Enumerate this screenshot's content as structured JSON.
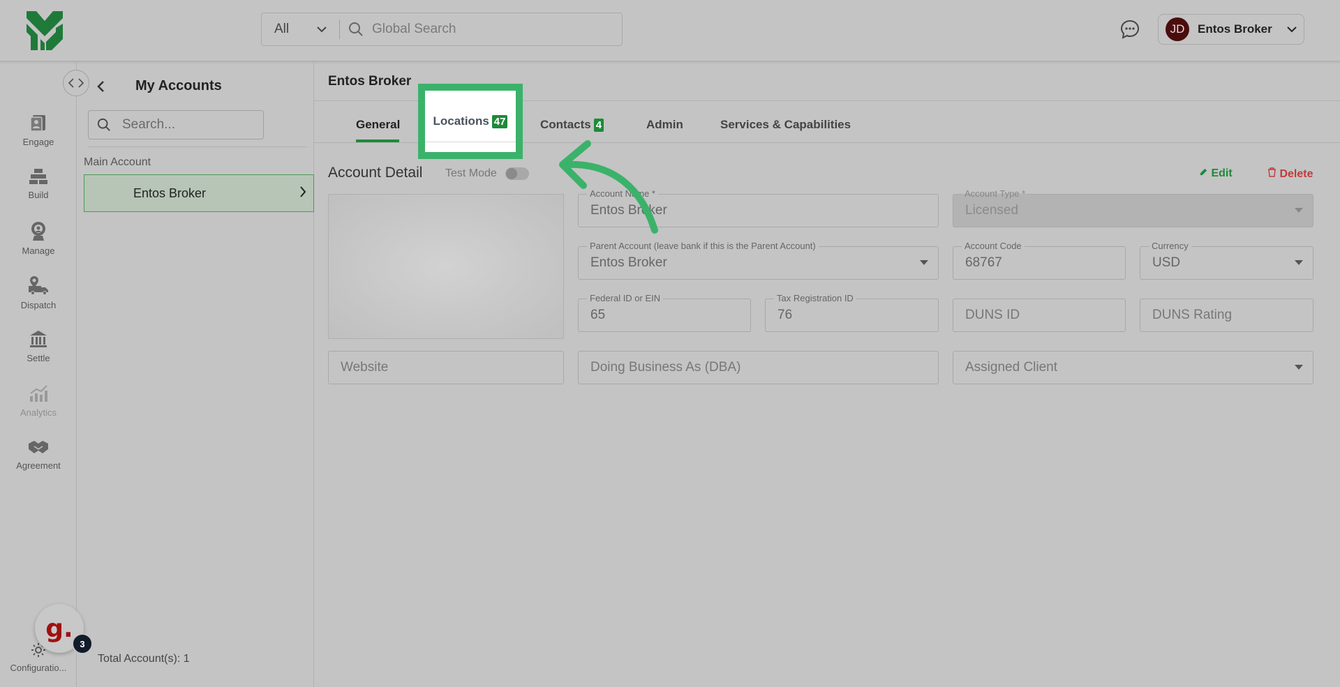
{
  "header": {
    "search": {
      "category": "All",
      "placeholder": "Global Search"
    },
    "user": {
      "initials": "JD",
      "name": "Entos Broker"
    }
  },
  "rail": {
    "items": [
      {
        "label": "Engage",
        "icon": "engage-icon"
      },
      {
        "label": "Build",
        "icon": "build-icon"
      },
      {
        "label": "Manage",
        "icon": "manage-icon"
      },
      {
        "label": "Dispatch",
        "icon": "dispatch-icon"
      },
      {
        "label": "Settle",
        "icon": "settle-icon"
      },
      {
        "label": "Analytics",
        "icon": "analytics-icon"
      },
      {
        "label": "Agreement",
        "icon": "agreement-icon"
      },
      {
        "label": "Configuratio...",
        "icon": "gear-icon"
      }
    ],
    "assistant": {
      "letter": "g.",
      "count": "3"
    }
  },
  "accounts": {
    "title": "My Accounts",
    "search_placeholder": "Search...",
    "section_label": "Main Account",
    "items": [
      {
        "name": "Entos Broker"
      }
    ],
    "total": "Total Account(s): 1"
  },
  "main": {
    "title": "Entos Broker",
    "tabs": [
      {
        "label": "General",
        "active": true
      },
      {
        "label": "Locations",
        "count": "47"
      },
      {
        "label": "Contacts",
        "count": "4"
      },
      {
        "label": "Admin"
      },
      {
        "label": "Services & Capabilities"
      }
    ],
    "detail": {
      "title": "Account Detail",
      "test_mode": "Test Mode",
      "edit": "Edit",
      "delete": "Delete",
      "fields": {
        "account_name": {
          "label": "Account Name *",
          "value": "Entos Broker"
        },
        "account_type": {
          "label": "Account Type *",
          "value": "Licensed"
        },
        "parent_account": {
          "label": "Parent Account (leave bank if this is the Parent Account)",
          "value": "Entos Broker"
        },
        "account_code": {
          "label": "Account Code",
          "value": "68767"
        },
        "currency": {
          "label": "Currency",
          "value": "USD"
        },
        "federal_id": {
          "label": "Federal ID or EIN",
          "value": "65"
        },
        "tax_id": {
          "label": "Tax Registration ID",
          "value": "76"
        },
        "duns_id": {
          "placeholder": "DUNS ID"
        },
        "duns_rating": {
          "placeholder": "DUNS Rating"
        },
        "website": {
          "placeholder": "Website"
        },
        "dba": {
          "placeholder": "Doing Business As (DBA)"
        },
        "assigned_client": {
          "placeholder": "Assigned Client"
        }
      }
    }
  },
  "colors": {
    "accent": "#1e8a3a",
    "highlight": "#3bb26a",
    "danger": "#c43a3a",
    "overlay": "#c4c4c4"
  }
}
